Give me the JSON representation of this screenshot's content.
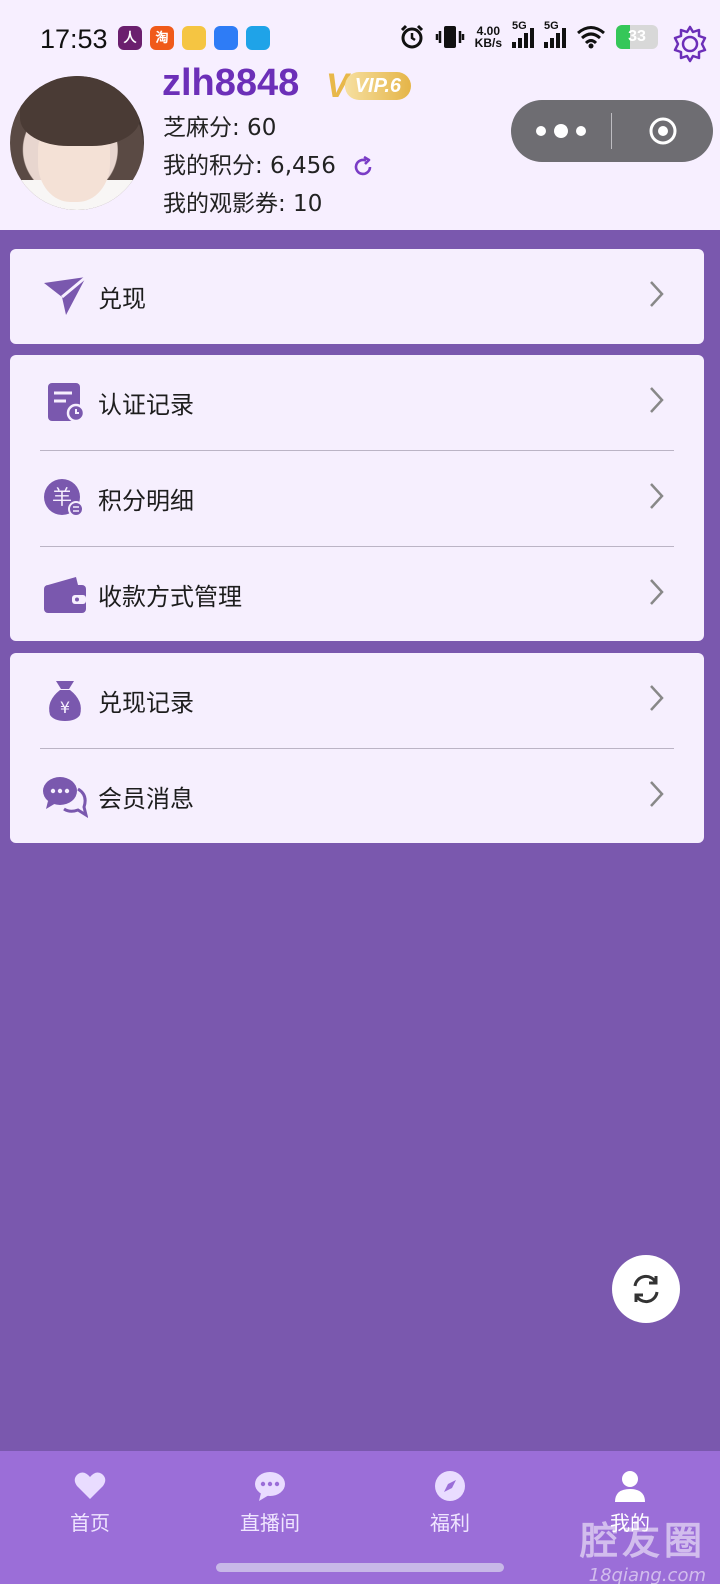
{
  "status_bar": {
    "time": "17:53",
    "net_speed_value": "4.00",
    "net_speed_unit": "KB/s",
    "signal1_label": "5G",
    "signal2_label": "5G",
    "battery": "33",
    "battery_level": 0.33,
    "app_icons": [
      {
        "glyph": "人",
        "color": "#6b1f6e"
      },
      {
        "glyph": "淘",
        "color": "#f05a1a"
      },
      {
        "glyph": "",
        "color": "#f5c542"
      },
      {
        "glyph": "",
        "color": "#2e7cf6"
      },
      {
        "glyph": "",
        "color": "#1fa3e8"
      }
    ]
  },
  "profile": {
    "username": "zlh8848",
    "vip_badge": "VIP.6",
    "sesame_label": "芝麻分: 60",
    "points_label": "我的积分: 6,456",
    "tickets_label": "我的观影券: 10"
  },
  "menu": {
    "group1": [
      {
        "label": "兑现",
        "icon": "paper-plane-icon"
      }
    ],
    "group2": [
      {
        "label": "认证记录",
        "icon": "record-clock-icon"
      },
      {
        "label": "积分明细",
        "icon": "yen-coin-icon"
      },
      {
        "label": "收款方式管理",
        "icon": "wallet-icon"
      }
    ],
    "group3": [
      {
        "label": "兑现记录",
        "icon": "money-bag-icon"
      },
      {
        "label": "会员消息",
        "icon": "chat-bubbles-icon"
      }
    ]
  },
  "bottom_nav": {
    "tabs": [
      {
        "label": "首页",
        "icon": "heart-icon"
      },
      {
        "label": "直播间",
        "icon": "chat-icon"
      },
      {
        "label": "福利",
        "icon": "compass-icon"
      },
      {
        "label": "我的",
        "icon": "user-icon"
      }
    ],
    "active_index": 3
  },
  "watermark": {
    "line1": "腔友圈",
    "line2": "18qiang.com"
  },
  "colors": {
    "accent": "#7a58ae",
    "username": "#6c2fb8",
    "header_bg": "#f7efff",
    "nav_bg": "#9b6ed8"
  }
}
